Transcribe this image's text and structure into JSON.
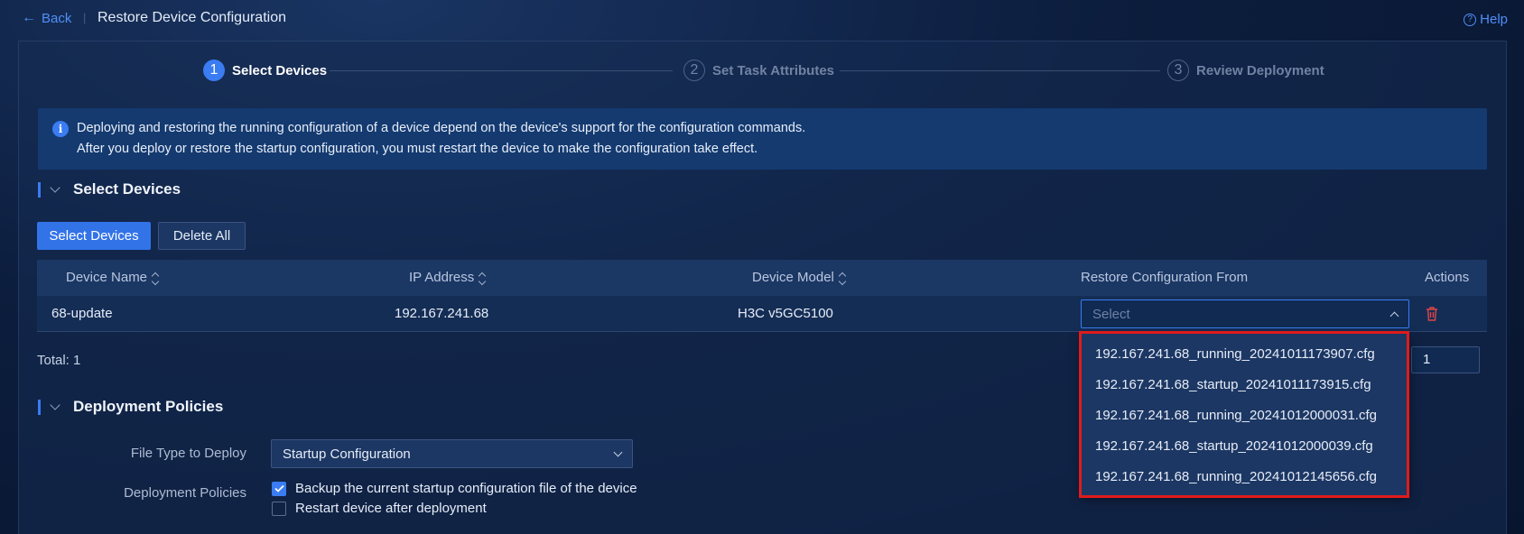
{
  "header": {
    "back_label": "Back",
    "separator": "|",
    "title": "Restore Device Configuration",
    "help_label": "Help"
  },
  "steps": [
    {
      "number": "1",
      "label": "Select Devices",
      "state": "active"
    },
    {
      "number": "2",
      "label": "Set Task Attributes",
      "state": "inactive"
    },
    {
      "number": "3",
      "label": "Review Deployment",
      "state": "inactive"
    }
  ],
  "info": {
    "line1": "Deploying and restoring the running configuration of a device depend on the device's support for the configuration commands.",
    "line2": "After you deploy or restore the startup configuration, you must restart the device to make the configuration take effect."
  },
  "select_devices_section": {
    "title": "Select Devices",
    "select_button": "Select Devices",
    "delete_all_button": "Delete All"
  },
  "table": {
    "columns": [
      "Device Name",
      "IP Address",
      "Device Model",
      "Restore Configuration From",
      "Actions"
    ],
    "rows": [
      {
        "device_name": "68-update",
        "ip_address": "192.167.241.68",
        "device_model": "H3C v5GC5100",
        "restore_from_placeholder": "Select"
      }
    ],
    "total": "Total: 1",
    "page": "1"
  },
  "dropdown": {
    "options": [
      "192.167.241.68_running_20241011173907.cfg",
      "192.167.241.68_startup_20241011173915.cfg",
      "192.167.241.68_running_20241012000031.cfg",
      "192.167.241.68_startup_20241012000039.cfg",
      "192.167.241.68_running_20241012145656.cfg"
    ]
  },
  "deployment_section": {
    "title": "Deployment Policies",
    "file_type_label": "File Type to Deploy",
    "file_type_value": "Startup Configuration",
    "policies_label": "Deployment Policies",
    "policies": [
      {
        "label": "Backup the current startup configuration file of the device",
        "checked": true
      },
      {
        "label": "Restart device after deployment",
        "checked": false
      }
    ]
  },
  "colors": {
    "accent": "#3a7cf2",
    "highlight": "#e01b1b",
    "danger": "#e04646"
  }
}
